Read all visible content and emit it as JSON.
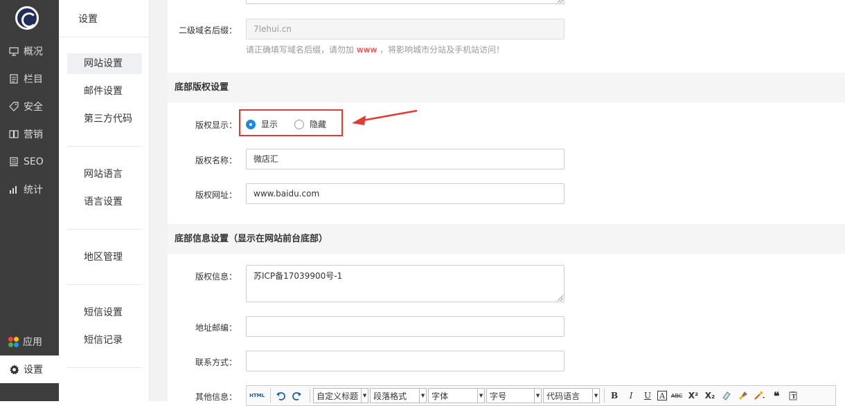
{
  "leftnav": {
    "items": [
      {
        "label": "概况",
        "icon": "monitor-icon"
      },
      {
        "label": "栏目",
        "icon": "document-icon"
      },
      {
        "label": "安全",
        "icon": "tag-icon"
      },
      {
        "label": "营销",
        "icon": "book-icon"
      },
      {
        "label": "SEO",
        "icon": "seo-icon"
      },
      {
        "label": "统计",
        "icon": "bar-chart-icon"
      }
    ],
    "apps_label": "应用",
    "settings_label": "设置"
  },
  "subnav": {
    "title": "设置",
    "items": [
      "网站设置",
      "邮件设置",
      "第三方代码",
      "网站语言",
      "语言设置",
      "地区管理",
      "短信设置",
      "短信记录"
    ]
  },
  "form": {
    "domain_suffix_label": "二级域名后缀：",
    "domain_suffix_value": "7lehui.cn",
    "domain_hint_pre": "请正确填写域名后缀，请勿加",
    "domain_hint_red": "www",
    "domain_hint_post": "，将影响城市分站及手机站访问！",
    "copyright_section": "底部版权设置",
    "copyright_display_label": "版权显示：",
    "radio_show": "显示",
    "radio_hide": "隐藏",
    "copyright_name_label": "版权名称：",
    "copyright_name_value": "微店汇",
    "copyright_url_label": "版权网址：",
    "copyright_url_value": "www.baidu.com",
    "footer_section": "底部信息设置（显示在网站前台底部）",
    "copyright_info_label": "版权信息：",
    "copyright_info_value": "苏ICP备17039900号-1",
    "address_label": "地址邮编：",
    "address_value": "",
    "contact_label": "联系方式：",
    "contact_value": "",
    "other_label": "其他信息："
  },
  "editor_toolbar": {
    "html": "HTML",
    "selects": [
      "自定义标题",
      "段落格式",
      "字体",
      "字号",
      "代码语言"
    ],
    "buttons": [
      "B",
      "I",
      "U",
      "A",
      "ABC",
      "X²",
      "X₂"
    ]
  },
  "colors": {
    "accent": "#1e88e5",
    "highlight": "#e53935",
    "nav_bg": "#3d3d3d"
  }
}
